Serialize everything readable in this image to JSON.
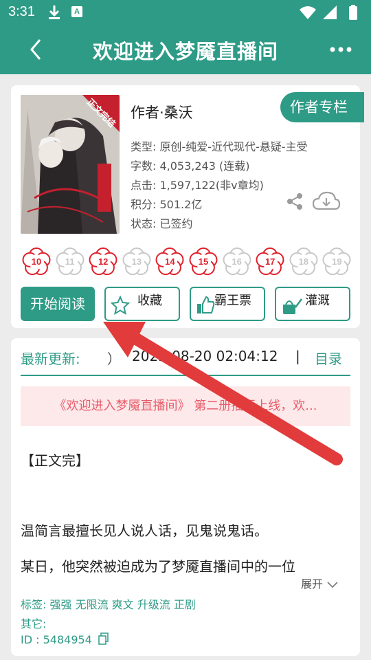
{
  "status_bar": {
    "time": "3:31",
    "note_icon": "A"
  },
  "app_bar": {
    "title": "欢迎进入梦魇直播间"
  },
  "book": {
    "cover_banner": "正文完结",
    "author": "作者·桑沃",
    "author_column_label": "作者专栏",
    "type": "类型: 原创-纯爱-近代现代-悬疑-主受",
    "word_count": "字数: 4,053,243 (连载)",
    "clicks": "点击: 1,597,122(非v章均)",
    "points": "积分: 501.2亿",
    "status": "状态: 已签约"
  },
  "flowers": [
    {
      "num": "10",
      "active": true
    },
    {
      "num": "11",
      "active": false
    },
    {
      "num": "12",
      "active": true
    },
    {
      "num": "13",
      "active": false
    },
    {
      "num": "14",
      "active": true
    },
    {
      "num": "15",
      "active": true
    },
    {
      "num": "16",
      "active": false
    },
    {
      "num": "17",
      "active": true
    },
    {
      "num": "18",
      "active": false
    },
    {
      "num": "19",
      "active": false
    }
  ],
  "actions": {
    "read": "开始阅读",
    "favorite": "收藏",
    "ticket": "霸王票",
    "water": "灌溉"
  },
  "update": {
    "label": "最新更新:",
    "paren": "）",
    "time": "2025-08-20 02:04:12",
    "separator": "|",
    "toc": "目录"
  },
  "notice": "《欢迎进入梦魇直播间》 第二册插画上线，欢...",
  "intro": {
    "line1": "【正文完】",
    "line2": "温简言最擅长见人说人话，见鬼说鬼话。",
    "line3": "某日，他突然被迫成为了梦魇直播间中的一位"
  },
  "expand_label": "展开",
  "tags": "标签: 强强 无限流 爽文 升级流 正剧",
  "other": "其它:",
  "id": "ID  : 5484954",
  "colors": {
    "accent": "#2e9b86",
    "flower_active": "#e0202a",
    "flower_inactive": "#c8c8c8",
    "arrow": "#e23b3b"
  }
}
